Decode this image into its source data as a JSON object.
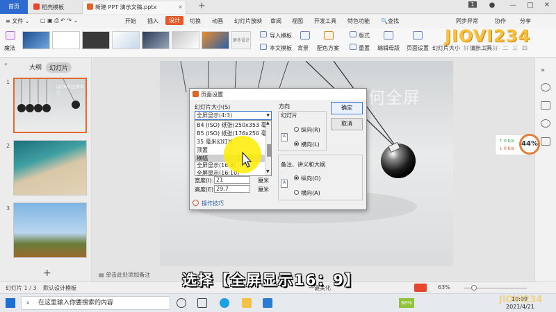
{
  "window": {
    "tabs": [
      {
        "label": "首页"
      },
      {
        "label": "稻壳模板"
      },
      {
        "label": "新建 PPT 演示文稿.pptx"
      }
    ],
    "new_tab": "+",
    "badge": "1",
    "controls": [
      "—",
      "□",
      "✕"
    ]
  },
  "menubar": {
    "file": "≡ 文件 ⌄",
    "items": [
      "开始",
      "插入",
      "设计",
      "切换",
      "动画",
      "幻灯片放映",
      "审阅",
      "视图",
      "开发工具",
      "特色功能"
    ],
    "active": "设计",
    "search": "🔍查找",
    "sync": "同步异常",
    "collab": "协作",
    "share": "分享"
  },
  "ribbon": {
    "magic": "魔法",
    "more_designs": "更多设计",
    "import_template": "导入模板",
    "text_template": "本文模板",
    "background": "背景",
    "color_scheme": "配色方案",
    "layout": "版式",
    "rearrange": "重置",
    "edit_master": "编辑母版",
    "page_setup": "页面设置",
    "slide_size": "幻灯片大小",
    "presentation_tools": "演示工具"
  },
  "left_panel": {
    "tab_outline": "大纲",
    "tab_slides": "幻灯片",
    "slides": [
      {
        "num": "1",
        "thumb_text": "ppt如何全屏显示"
      },
      {
        "num": "2"
      },
      {
        "num": "3"
      }
    ],
    "add": "+"
  },
  "slide": {
    "title": "如何全屏"
  },
  "dialog": {
    "title": "页面设置",
    "size_label": "幻灯片大小(S)",
    "size_value": "全屏显示(4:3)",
    "options": [
      "B4 (ISO) 纸张(250x353 毫米)",
      "B5 (ISO) 纸张(176x250 毫米)",
      "35 毫米幻灯片",
      "顶置",
      "横幅",
      "全屏显示(16:9)",
      "全屏显示(16:10)"
    ],
    "highlighted_option": "横幅",
    "width_label": "宽度(I):",
    "width_value": "21",
    "height_label": "高度(E):",
    "height_value": "29.7",
    "unit": "厘米",
    "orientation": "方向",
    "slides_group": "幻灯片",
    "portrait": "纵向(R)",
    "landscape": "横向(L)",
    "notes_group": "备注、讲义和大纲",
    "notes_portrait": "纵向(O)",
    "notes_landscape": "横向(A)",
    "ok": "确定",
    "cancel": "取消",
    "tips": "操作技巧"
  },
  "notes_placeholder": "单击此处添加备注",
  "status": {
    "slide_count": "幻灯片 1 / 3",
    "template": "默认设计模板",
    "beautify": "一键美化",
    "zoom": "63%"
  },
  "caption": "选择【全屏显示16：9】",
  "perf": {
    "up": "0 K/s",
    "down": "0 K/s",
    "percent": "44%"
  },
  "taskbar": {
    "search_placeholder": "在这里输入你要搜索的内容",
    "battery": "66%",
    "time": "10:09",
    "date": "2021/4/21"
  },
  "logo": {
    "text": "JIOVI234",
    "sub": "好生活好二三四"
  }
}
